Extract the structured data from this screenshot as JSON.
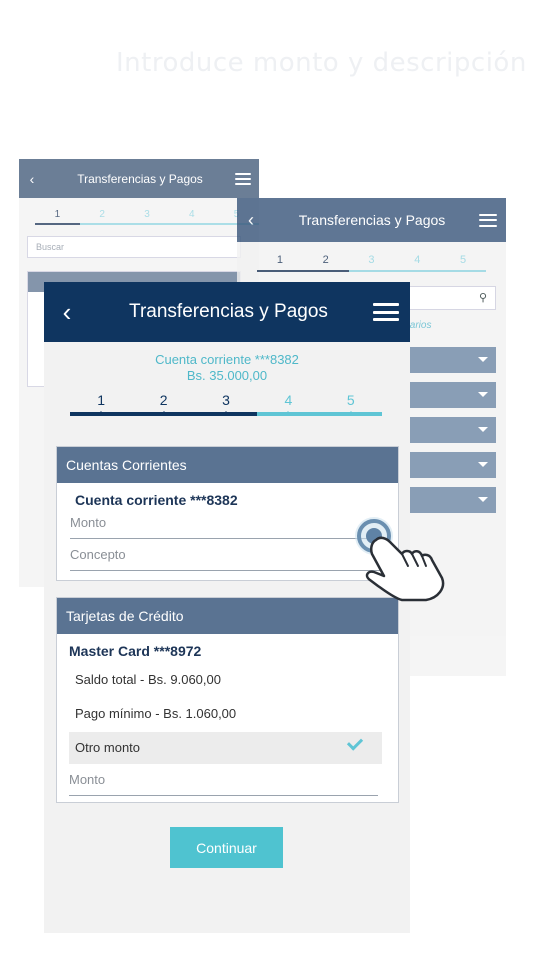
{
  "caption": "Introduce monto y descripción",
  "back_phone_1": {
    "title": "Transferencias y Pagos",
    "steps": [
      "1",
      "2",
      "3",
      "4",
      "5"
    ],
    "search_placeholder": "Buscar"
  },
  "back_phone_2": {
    "title": "Transferencias y Pagos",
    "steps": [
      "1",
      "2",
      "3",
      "4",
      "5"
    ],
    "favs_fragment": "tarios"
  },
  "main": {
    "title": "Transferencias y Pagos",
    "account": "Cuenta corriente ***8382",
    "balance": "Bs. 35.000,00",
    "steps": [
      "1",
      "2",
      "3",
      "4",
      "5"
    ],
    "current_step": 3,
    "section_checking": "Cuentas Corrientes",
    "checking_account": "Cuenta corriente ***8382",
    "amount_placeholder": "Monto",
    "concept_placeholder": "Concepto",
    "section_credit": "Tarjetas de Crédito",
    "card_name": "Master Card ***8972",
    "total_balance": "Saldo total -  Bs. 9.060,00",
    "min_payment": "Pago mínimo - Bs. 1.060,00",
    "other_amount": "Otro monto",
    "other_amount_placeholder": "Monto",
    "continue_label": "Continuar"
  },
  "colors": {
    "header_main": "#0f3560",
    "section_header": "#5a7392",
    "accent": "#4fc3d0"
  }
}
